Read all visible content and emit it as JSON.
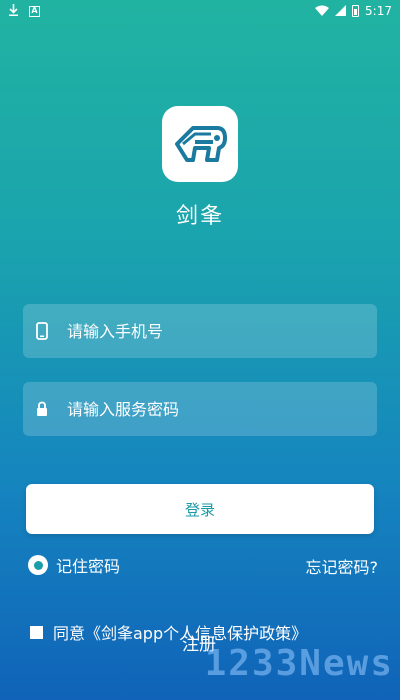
{
  "status_bar": {
    "time": "5:17",
    "left_icons": [
      "download-icon",
      "a-box-icon"
    ],
    "right_icons": [
      "wifi-icon",
      "signal-icon",
      "battery-icon"
    ]
  },
  "app": {
    "name": "剑夆"
  },
  "form": {
    "phone_placeholder": "请输入手机号",
    "password_placeholder": "请输入服务密码",
    "login_label": "登录",
    "remember_label": "记住密码",
    "forgot_label": "忘记密码?",
    "agree_label": "同意《剑夆app个人信息保护政策》",
    "register_label": "注册"
  },
  "watermark": "1233News",
  "colors": {
    "gradient_top": "#21b3a2",
    "gradient_bottom": "#1063b8",
    "button_text": "#1b9aa7"
  }
}
